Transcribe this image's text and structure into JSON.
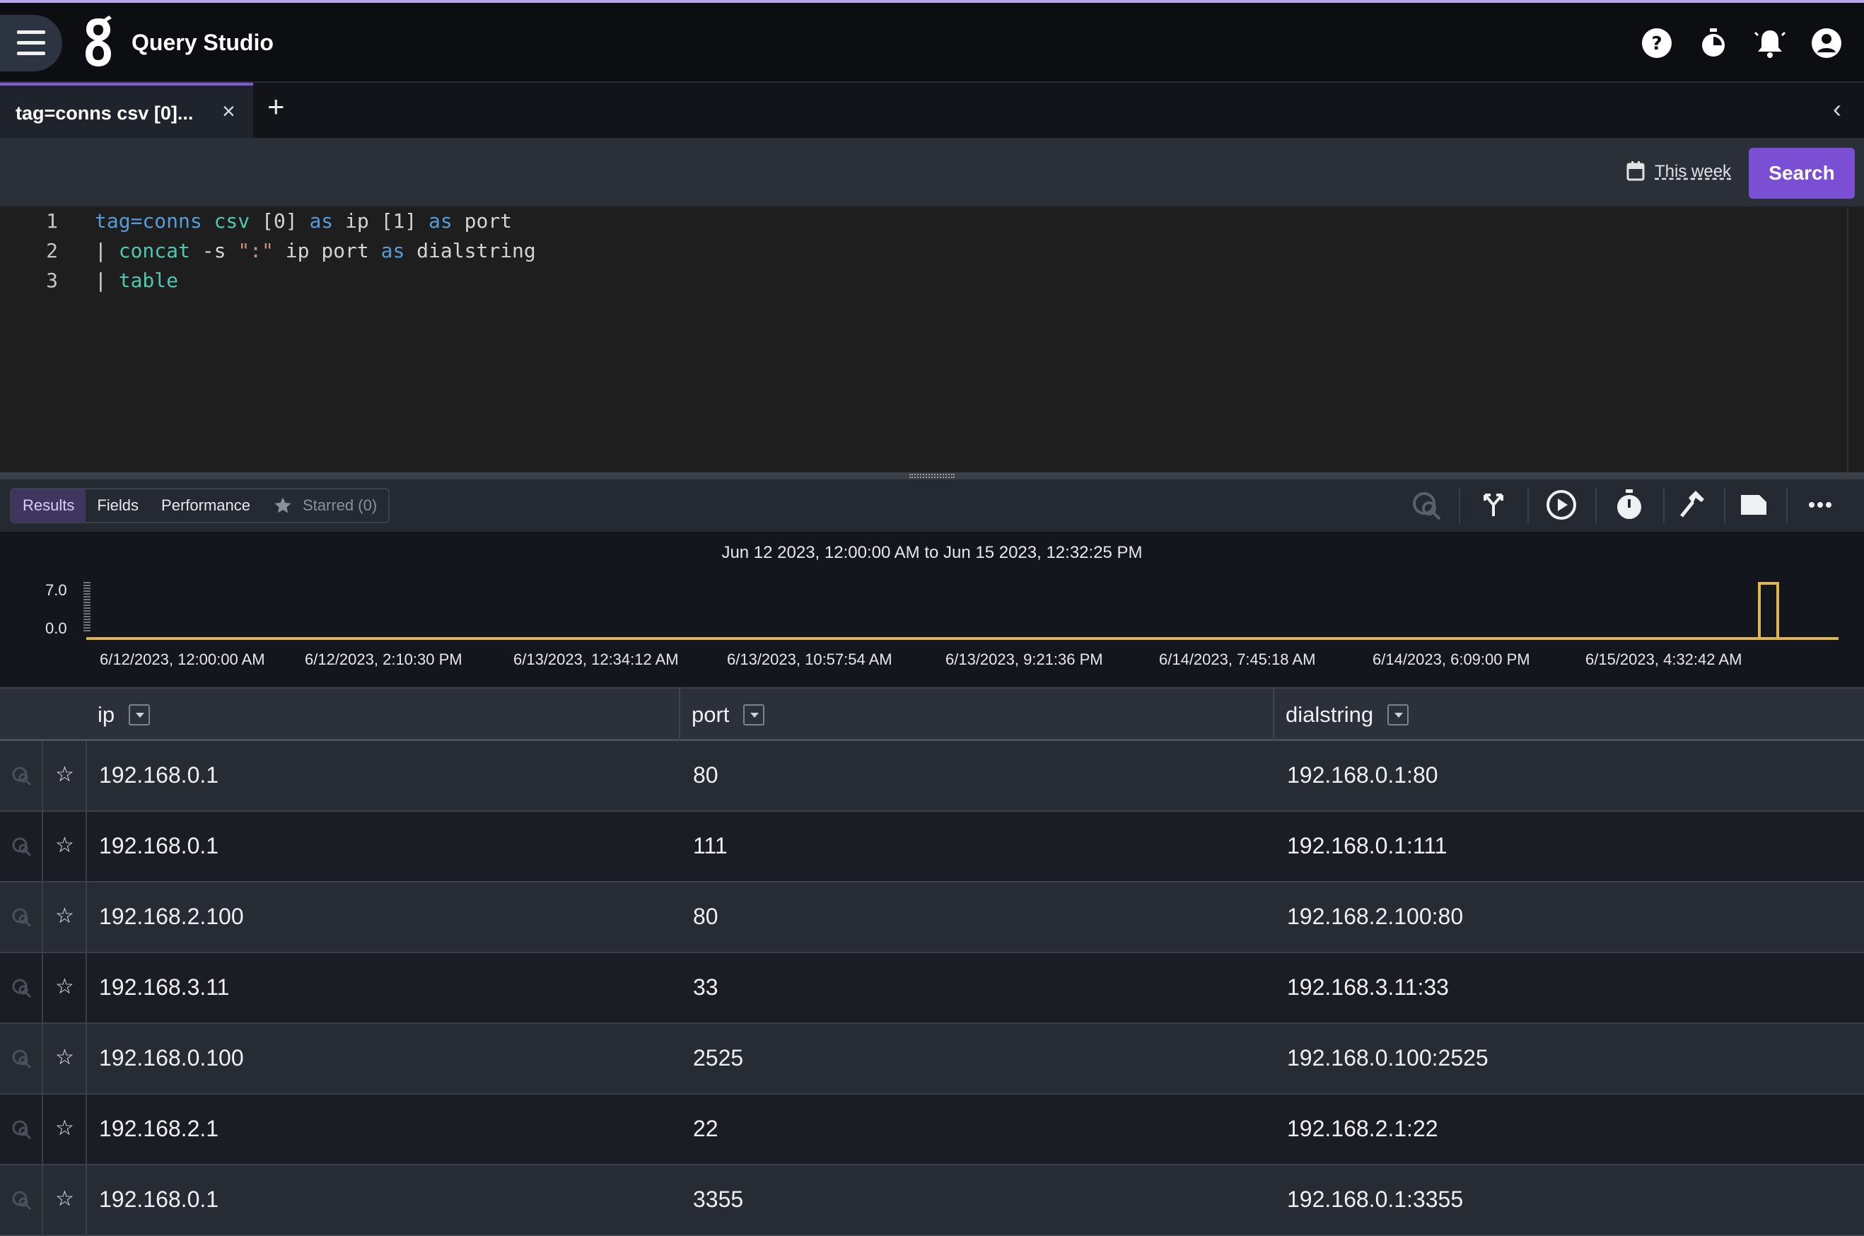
{
  "app": {
    "title": "Query Studio"
  },
  "top_icons": [
    "help-icon",
    "timer-icon",
    "notification-bell-icon",
    "account-icon"
  ],
  "tabs": [
    {
      "label": "tag=conns csv [0]...",
      "close": "×"
    }
  ],
  "add_tab": "+",
  "collapse": "‹",
  "toolbar": {
    "timeframe": "This week",
    "search_label": "Search"
  },
  "editor": {
    "line_numbers": [
      "1",
      "2",
      "3"
    ]
  },
  "results": {
    "tabs": [
      "Results",
      "Fields",
      "Performance"
    ],
    "starred_label": "Starred (0)",
    "active_tab": "Results"
  },
  "histogram": {
    "title": "Jun 12 2023, 12:00:00 AM to Jun 15 2023, 12:32:25 PM",
    "y_ticks": [
      "7.0",
      "0.0"
    ],
    "x_ticks": [
      "6/12/2023, 12:00:00 AM",
      "6/12/2023, 2:10:30 PM",
      "6/13/2023, 12:34:12 AM",
      "6/13/2023, 10:57:54 AM",
      "6/13/2023, 9:21:36 PM",
      "6/14/2023, 7:45:18 AM",
      "6/14/2023, 6:09:00 PM",
      "6/15/2023, 4:32:42 AM"
    ],
    "accent": "#e0b64a"
  },
  "table": {
    "columns": [
      "ip",
      "port",
      "dialstring"
    ],
    "rows": [
      [
        "192.168.0.1",
        "80",
        "192.168.0.1:80"
      ],
      [
        "192.168.0.1",
        "111",
        "192.168.0.1:111"
      ],
      [
        "192.168.2.100",
        "80",
        "192.168.2.100:80"
      ],
      [
        "192.168.3.11",
        "33",
        "192.168.3.11:33"
      ],
      [
        "192.168.0.100",
        "2525",
        "192.168.0.100:2525"
      ],
      [
        "192.168.2.1",
        "22",
        "192.168.2.1:22"
      ],
      [
        "192.168.0.1",
        "3355",
        "192.168.0.1:3355"
      ]
    ],
    "star_glyph": "☆"
  },
  "colors": {
    "brand": "#7b4fd4",
    "tab_accent": "#7c5cd6"
  }
}
